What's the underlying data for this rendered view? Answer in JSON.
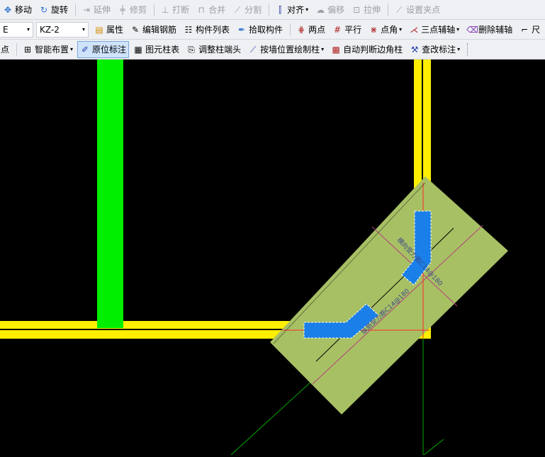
{
  "toolbar1": {
    "move": "移动",
    "rotate": "旋转",
    "extend": "延伸",
    "trim": "修剪",
    "break": "打断",
    "merge": "合并",
    "split": "分割",
    "align": "对齐",
    "offset": "偏移",
    "stretch": "拉伸",
    "grip": "设置夹点"
  },
  "toolbar2": {
    "category_value": "E",
    "component_value": "KZ-2",
    "properties": "属性",
    "edit_rebar": "编辑钢筋",
    "component_list": "构件列表",
    "pick_component": "拾取构件",
    "two_points": "两点",
    "parallel": "平行",
    "point_angle": "点角",
    "three_point_axis": "三点辅轴",
    "delete_axis": "删除辅轴",
    "truncated": "尺"
  },
  "toolbar3": {
    "point": "点",
    "smart_layout": "智能布置",
    "in_place_label": "原位标注",
    "element_column_table": "图元柱表",
    "adjust_column_end": "调整柱端头",
    "draw_by_wall": "按墙位置绘制柱",
    "auto_edge_column": "自动判断边角柱",
    "check_label": "查改标注"
  },
  "canvas": {
    "colors": {
      "background": "#000000",
      "beam": "#ffee00",
      "column": "#00ee00",
      "hidden_column": "#a8c064",
      "rebar": "#1a7fe8",
      "axis": "#ff2a2a",
      "dim": "#b0407a",
      "guide": "#00aa00"
    },
    "rebar_label_1": "纵筋受力筋C14@180",
    "rebar_label_2": "横向受力筋C14@180"
  }
}
